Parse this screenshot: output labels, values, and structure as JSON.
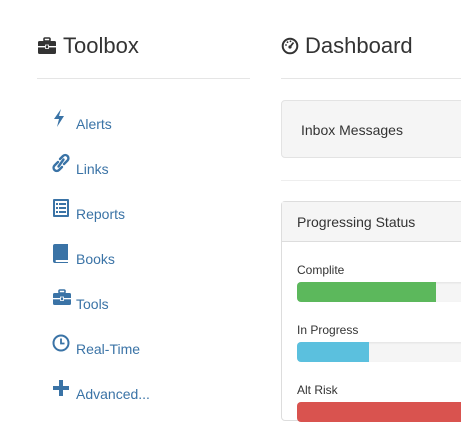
{
  "sidebar": {
    "title": "Toolbox",
    "title_icon": "toolbox-icon",
    "items": [
      {
        "label": "Alerts",
        "icon": "bolt-icon"
      },
      {
        "label": "Links",
        "icon": "link-icon"
      },
      {
        "label": "Reports",
        "icon": "list-alt-icon"
      },
      {
        "label": "Books",
        "icon": "book-icon"
      },
      {
        "label": "Tools",
        "icon": "briefcase-icon"
      },
      {
        "label": "Real-Time",
        "icon": "clock-icon"
      },
      {
        "label": "Advanced...",
        "icon": "plus-icon"
      }
    ]
  },
  "main": {
    "title": "Dashboard",
    "title_icon": "dashboard-gauge-icon",
    "inbox_label": "Inbox Messages",
    "status_panel": {
      "heading": "Progressing Status",
      "rows": [
        {
          "label": "Complite",
          "percent": 75,
          "color": "#5cb85c"
        },
        {
          "label": "In Progress",
          "percent": 39,
          "color": "#5bc0de"
        },
        {
          "label": "Alt Risk",
          "percent": 100,
          "color": "#d9534f"
        }
      ]
    }
  },
  "colors": {
    "link": "#3a73a6",
    "text": "#333333"
  }
}
